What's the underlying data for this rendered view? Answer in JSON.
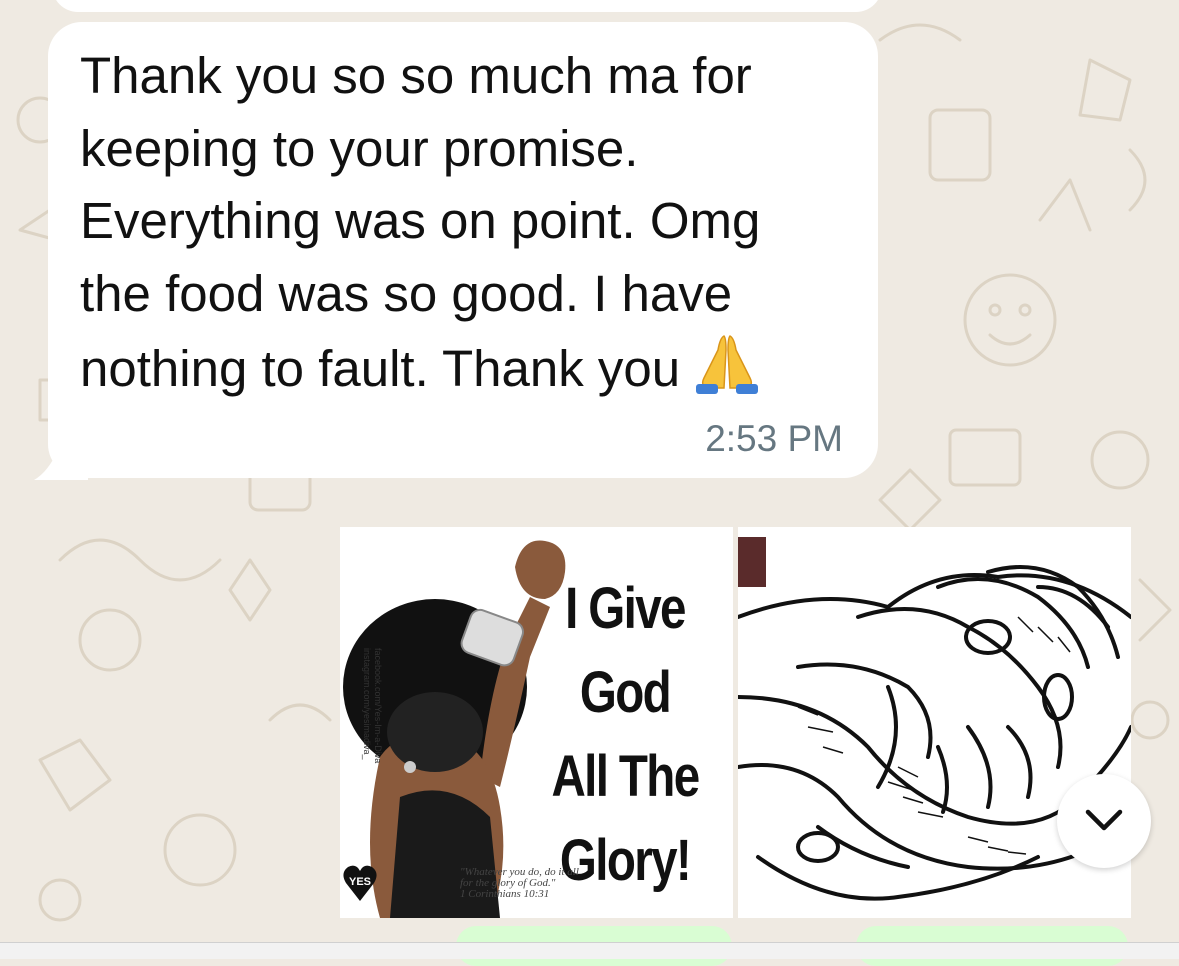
{
  "message": {
    "lines": [
      "Thank you so so much ma for",
      "keeping to your promise.",
      "Everything was on point. Omg",
      "the food was so good. I have",
      "nothing to fault. Thank you"
    ],
    "emoji": "folded-hands-icon",
    "time": "2:53 PM"
  },
  "images": {
    "left": {
      "title_lines": [
        "I Give",
        "God",
        "All The",
        "Glory!"
      ],
      "quote_lines": [
        "\"Whatever you do, do it all",
        "for the glory of God.\"",
        "1 Corinthians 10:31"
      ],
      "credit_lines": [
        "facebook.com/Yes-Im-a-Diva",
        "instagram.com/yesimadiva_"
      ],
      "logo_text": "YES"
    },
    "right": {
      "description": "handshake-illustration"
    }
  },
  "colors": {
    "background": "#efeae2",
    "bubble": "#ffffff",
    "text": "#111111",
    "timestamp": "#667781",
    "sent_bubble": "#d9fdd3"
  },
  "controls": {
    "scroll_down_icon": "chevron-down-icon"
  }
}
